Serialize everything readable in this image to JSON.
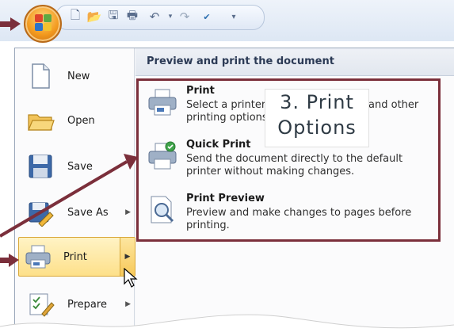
{
  "quick_access": {
    "buttons": [
      "new-doc",
      "open-folder",
      "save",
      "print",
      "undo",
      "redo",
      "spelling",
      "customize"
    ]
  },
  "menu": {
    "items": [
      {
        "label": "New",
        "icon": "new-page-icon",
        "arrow": ""
      },
      {
        "label": "Open",
        "icon": "open-folder-icon",
        "arrow": ""
      },
      {
        "label": "Save",
        "icon": "save-disk-icon",
        "arrow": ""
      },
      {
        "label": "Save As",
        "icon": "save-as-icon",
        "arrow": "▶"
      },
      {
        "label": "Print",
        "icon": "printer-icon",
        "arrow": "▶"
      },
      {
        "label": "Prepare",
        "icon": "prepare-icon",
        "arrow": "▶"
      }
    ]
  },
  "panel": {
    "heading": "Preview and print the document",
    "options": [
      {
        "title": "Print",
        "desc": "Select a printer, number of copies, and other printing options before printing."
      },
      {
        "title": "Quick Print",
        "desc": "Send the document directly to the default printer without making changes."
      },
      {
        "title": "Print Preview",
        "desc": "Preview and make changes to pages before printing."
      }
    ]
  },
  "annotation": {
    "line1": "3. Print",
    "line2": "Options",
    "color": "#7b2f3b"
  }
}
